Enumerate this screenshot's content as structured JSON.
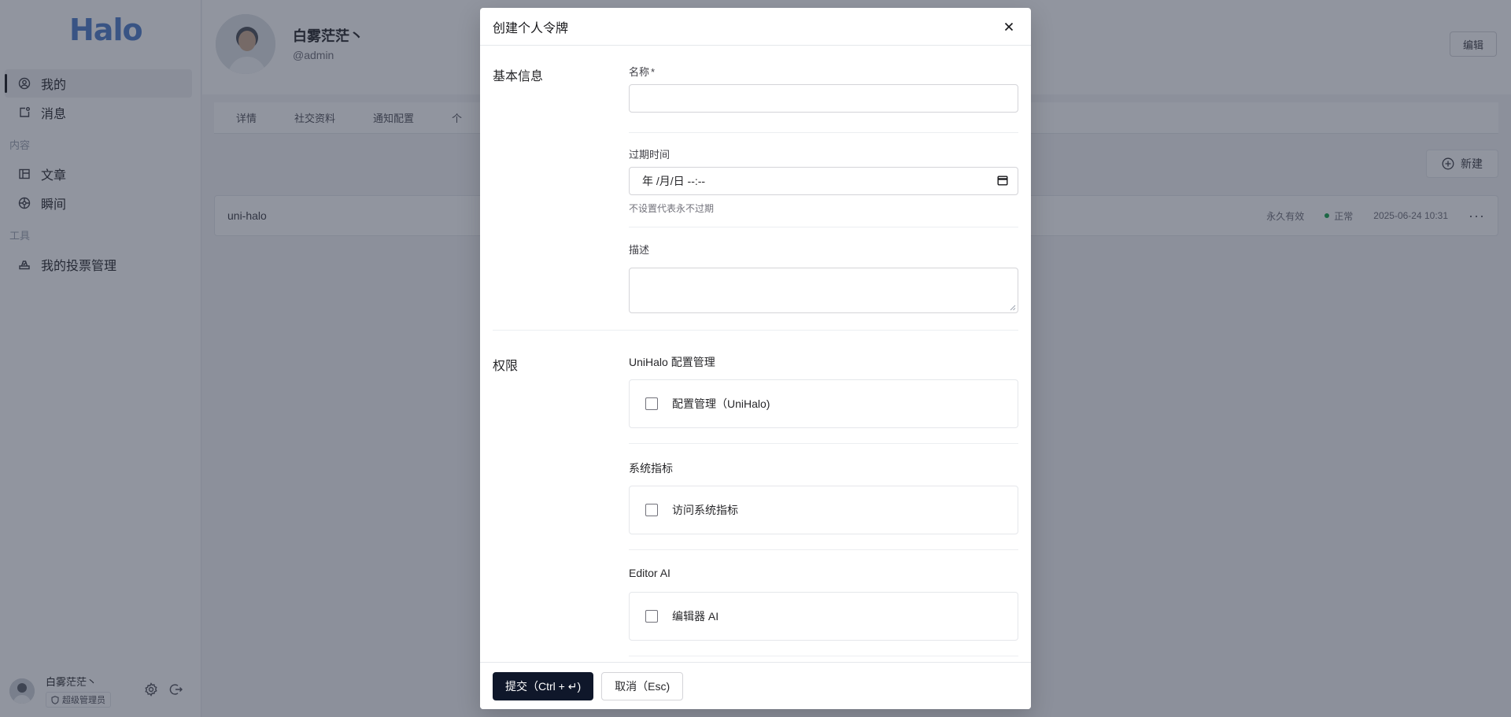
{
  "app": {
    "logo": "Halo"
  },
  "sidebar": {
    "items": [
      {
        "label": "我的",
        "icon": "user-circle-icon"
      },
      {
        "label": "消息",
        "icon": "message-icon"
      },
      {
        "label": "文章",
        "icon": "book-icon"
      },
      {
        "label": "瞬间",
        "icon": "moment-icon"
      },
      {
        "label": "我的投票管理",
        "icon": "vote-icon"
      }
    ],
    "groups": {
      "content": "内容",
      "tools": "工具"
    },
    "user": {
      "name": "白雾茫茫丶",
      "role": "超级管理员"
    }
  },
  "profile": {
    "name": "白雾茫茫丶",
    "handle": "@admin",
    "edit_label": "编辑"
  },
  "tabs": [
    "详情",
    "社交资料",
    "通知配置",
    "个"
  ],
  "toolbar": {
    "new_label": "新建"
  },
  "token_row": {
    "name": "uni-halo",
    "expiry": "永久有效",
    "status": "正常",
    "created": "2025-06-24 10:31",
    "status_color": "#16a34a"
  },
  "modal": {
    "title": "创建个人令牌",
    "basic_section": "基本信息",
    "name_label": "名称",
    "required_mark": "*",
    "expire_label": "过期时间",
    "expire_placeholder": "年 /月/日 --:--",
    "expire_help": "不设置代表永不过期",
    "desc_label": "描述",
    "perm_section": "权限",
    "permissions": [
      {
        "group": "UniHalo 配置管理",
        "option": "配置管理（UniHalo)"
      },
      {
        "group": "系统指标",
        "option": "访问系统指标"
      },
      {
        "group": "Editor AI",
        "option": "编辑器 AI"
      }
    ],
    "submit_label": "提交（Ctrl + ↵)",
    "cancel_label": "取消（Esc)",
    "primary_color": "#0f172a"
  }
}
